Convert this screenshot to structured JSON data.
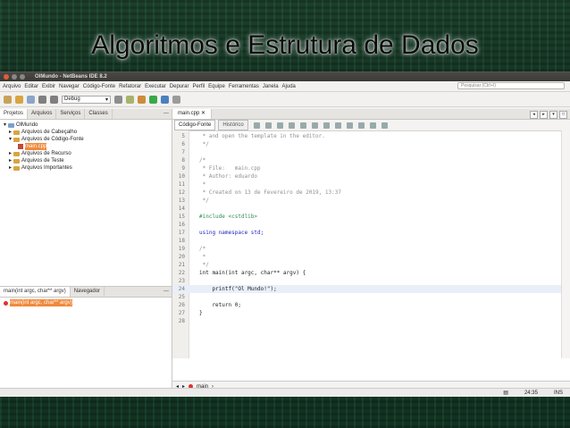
{
  "slide": {
    "title": "Algoritmos e Estrutura de Dados"
  },
  "window": {
    "title": "OlMundo - NetBeans IDE 8.2",
    "menu": [
      "Arquivo",
      "Editar",
      "Exibir",
      "Navegar",
      "Código-Fonte",
      "Refatorar",
      "Executar",
      "Depurar",
      "Perfil",
      "Equipe",
      "Ferramentas",
      "Janela",
      "Ajuda"
    ],
    "search_placeholder": "Pesquisar (Ctrl+I)",
    "config_combo": "Debug"
  },
  "projects": {
    "tabs": [
      "Projetos",
      "Arquivos",
      "Serviços",
      "Classes"
    ],
    "tree": [
      {
        "label": "OlMundo",
        "indent": 0,
        "kind": "project"
      },
      {
        "label": "Arquivos de Cabeçalho",
        "indent": 1,
        "kind": "folder"
      },
      {
        "label": "Arquivos de Código-Fonte",
        "indent": 1,
        "kind": "folder"
      },
      {
        "label": "main.cpp",
        "indent": 2,
        "kind": "file",
        "selected": true
      },
      {
        "label": "Arquivos de Recurso",
        "indent": 1,
        "kind": "folder"
      },
      {
        "label": "Arquivos de Teste",
        "indent": 1,
        "kind": "folder"
      },
      {
        "label": "Arquivos Importantes",
        "indent": 1,
        "kind": "folder"
      }
    ]
  },
  "navigator": {
    "tabs": [
      "main(int argc, char** argv)",
      "Navegador"
    ],
    "item": "main(int argc, char** argv)"
  },
  "editor": {
    "file_tab": "main.cpp",
    "source_tab": "Código-Fonte",
    "history_tab": "Histórico",
    "lines": [
      {
        "n": "5",
        "t": " * and open the template in the editor.",
        "cls": "cmt"
      },
      {
        "n": "6",
        "t": " */",
        "cls": "cmt"
      },
      {
        "n": "7",
        "t": "",
        "cls": ""
      },
      {
        "n": "8",
        "t": "/*",
        "cls": "cmt"
      },
      {
        "n": "9",
        "t": " * File:   main.cpp",
        "cls": "cmt"
      },
      {
        "n": "10",
        "t": " * Author: eduardo",
        "cls": "cmt"
      },
      {
        "n": "11",
        "t": " *",
        "cls": "cmt"
      },
      {
        "n": "12",
        "t": " * Created on 13 de Fevereiro de 2019, 13:37",
        "cls": "cmt"
      },
      {
        "n": "13",
        "t": " */",
        "cls": "cmt"
      },
      {
        "n": "14",
        "t": "",
        "cls": ""
      },
      {
        "n": "15",
        "t": "#include <cstdlib>",
        "cls": "pp"
      },
      {
        "n": "16",
        "t": "",
        "cls": ""
      },
      {
        "n": "17",
        "t": "using namespace std;",
        "cls": "kw"
      },
      {
        "n": "18",
        "t": "",
        "cls": ""
      },
      {
        "n": "19",
        "t": "/*",
        "cls": "cmt"
      },
      {
        "n": "20",
        "t": " *",
        "cls": "cmt"
      },
      {
        "n": "21",
        "t": " */",
        "cls": "cmt"
      },
      {
        "n": "22",
        "t": "int main(int argc, char** argv) {",
        "cls": ""
      },
      {
        "n": "23",
        "t": "",
        "cls": ""
      },
      {
        "n": "24",
        "t": "    printf(\"Ol Mundo!\");",
        "cls": "",
        "hl": true
      },
      {
        "n": "25",
        "t": "",
        "cls": ""
      },
      {
        "n": "26",
        "t": "    return 0;",
        "cls": ""
      },
      {
        "n": "27",
        "t": "}",
        "cls": ""
      },
      {
        "n": "28",
        "t": "",
        "cls": ""
      }
    ],
    "nav_breadcrumb": "main"
  },
  "status": {
    "position": "24:35",
    "mode": "INS"
  }
}
